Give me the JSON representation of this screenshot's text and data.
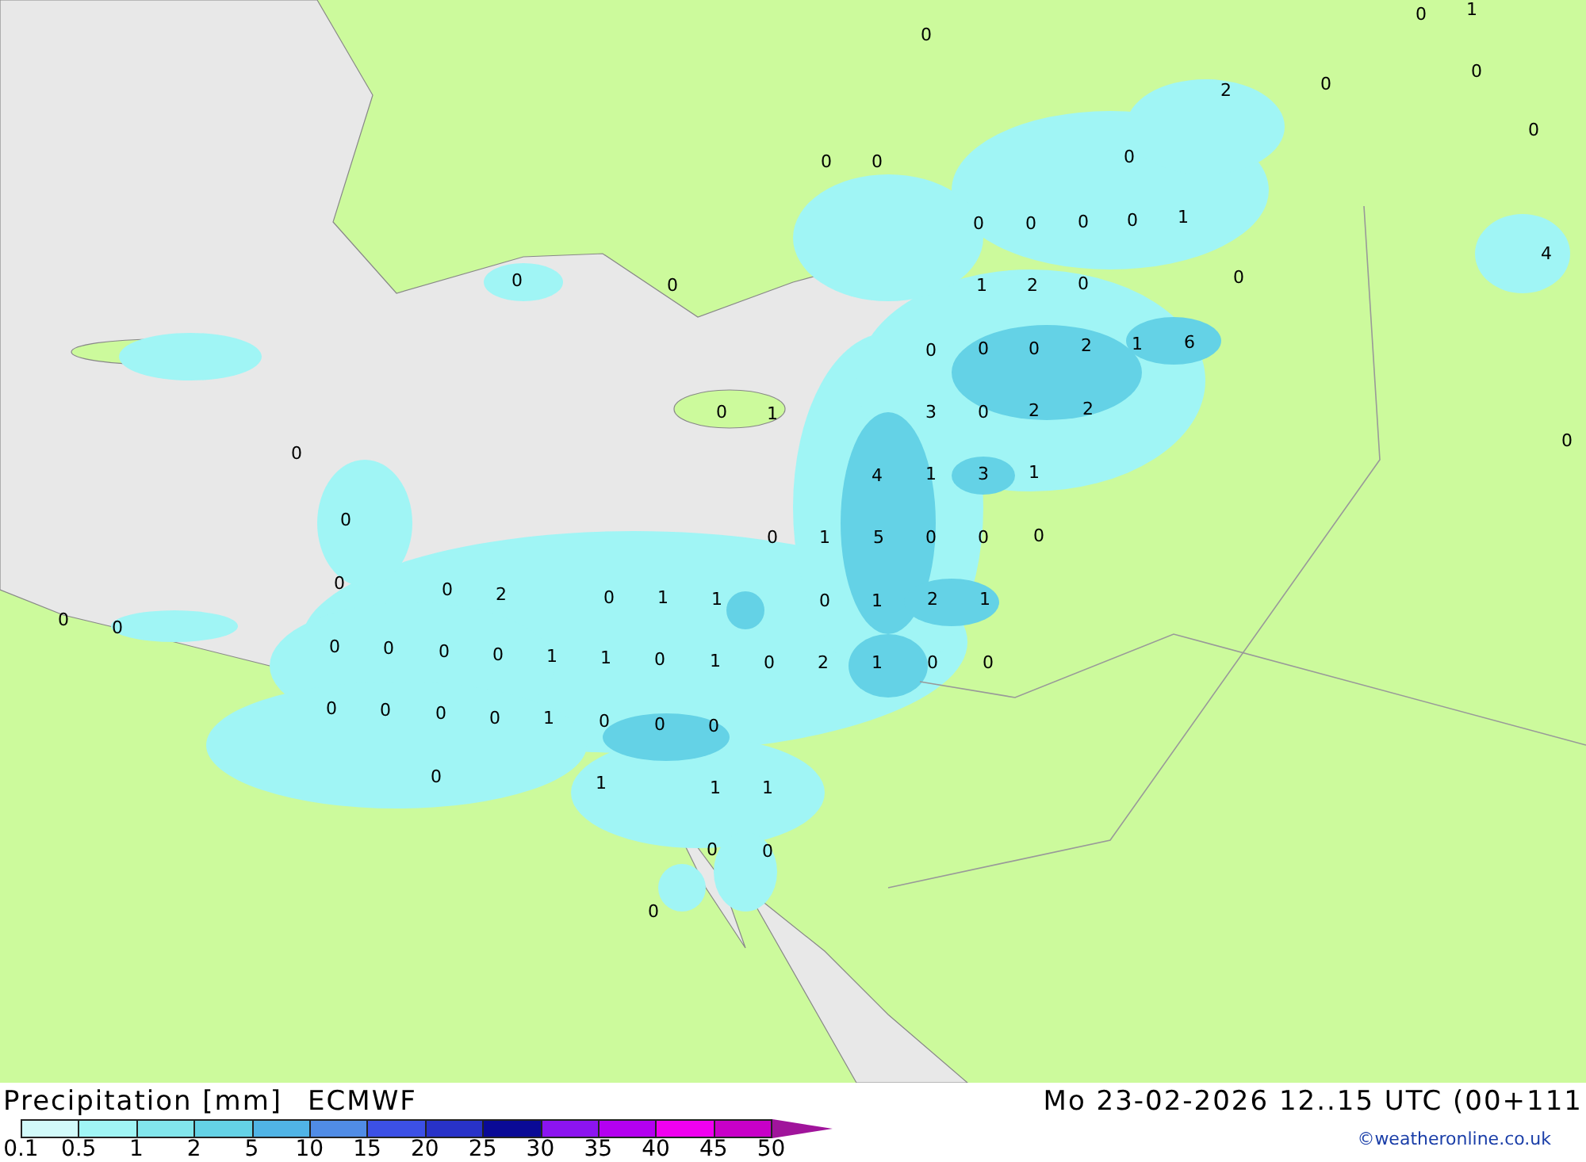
{
  "map": {
    "labels": [
      "0",
      "0",
      "1",
      "2",
      "0",
      "0",
      "0",
      "0",
      "0",
      "0",
      "0",
      "0",
      "0",
      "0",
      "1",
      "4",
      "0",
      "0",
      "1",
      "2",
      "0",
      "0",
      "0",
      "0",
      "0",
      "2",
      "1",
      "6",
      "0",
      "1",
      "3",
      "0",
      "2",
      "2",
      "0",
      "0",
      "4",
      "1",
      "3",
      "1",
      "0",
      "0",
      "1",
      "5",
      "0",
      "0",
      "0",
      "0",
      "0",
      "2",
      "0",
      "1",
      "1",
      "0",
      "1",
      "2",
      "1",
      "0",
      "0",
      "0",
      "0",
      "0",
      "0",
      "1",
      "1",
      "0",
      "1",
      "0",
      "2",
      "1",
      "0",
      "0",
      "0",
      "0",
      "0",
      "0",
      "1",
      "0",
      "0",
      "0",
      "0",
      "1",
      "1",
      "1",
      "0",
      "0",
      "0"
    ]
  },
  "legend": {
    "title": "Precipitation [mm]",
    "model": "ECMWF",
    "valid_time": "Mo 23-02-2026 12..15 UTC (00+111",
    "credit": "©weatheronline.co.uk",
    "scale": [
      {
        "label": "0.1",
        "color": "#d2fafa"
      },
      {
        "label": "0.5",
        "color": "#a0f5f5"
      },
      {
        "label": "1",
        "color": "#82e6ec"
      },
      {
        "label": "2",
        "color": "#64d2e6"
      },
      {
        "label": "5",
        "color": "#50b4e6"
      },
      {
        "label": "10",
        "color": "#508ce6"
      },
      {
        "label": "15",
        "color": "#3c50e6"
      },
      {
        "label": "20",
        "color": "#2832c8"
      },
      {
        "label": "25",
        "color": "#0a0a96"
      },
      {
        "label": "30",
        "color": "#8c14f0"
      },
      {
        "label": "35",
        "color": "#b400f0"
      },
      {
        "label": "40",
        "color": "#f000f0"
      },
      {
        "label": "45",
        "color": "#c800c8"
      },
      {
        "label": "50",
        "color": "#a0149b"
      }
    ]
  }
}
